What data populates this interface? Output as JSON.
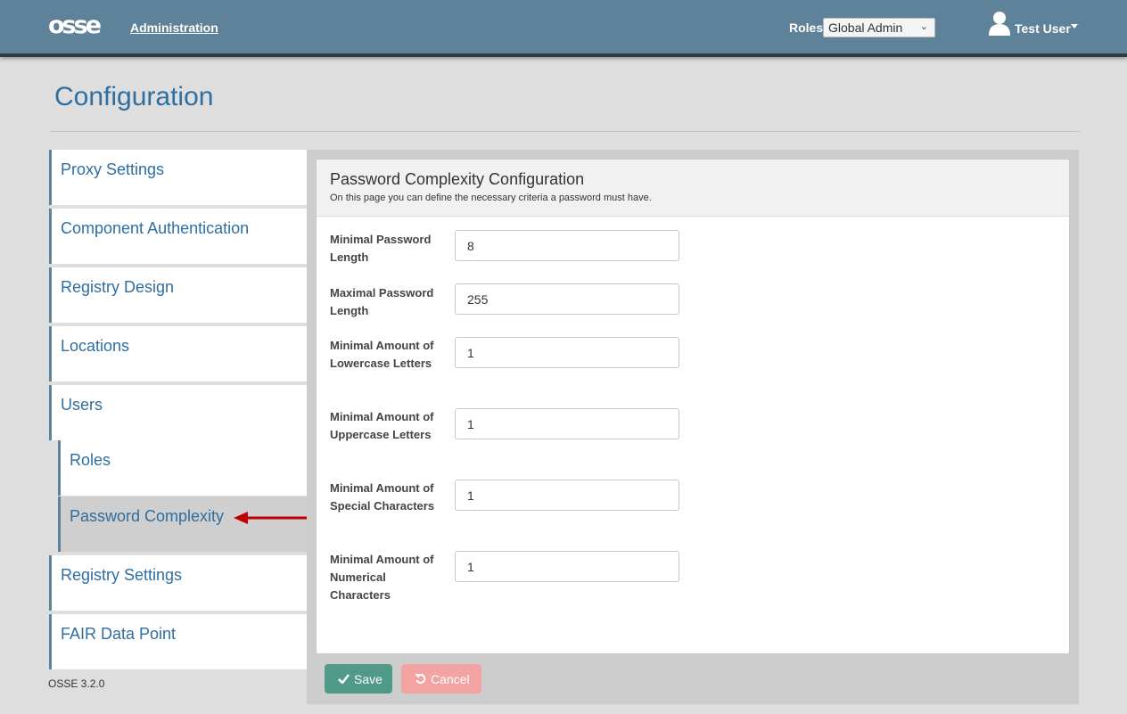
{
  "navbar": {
    "logo": "osse",
    "admin_link": "Administration",
    "roles_label": "Roles",
    "roles_selected": "Global Admin",
    "user_name": "Test User"
  },
  "page": {
    "title": "Configuration",
    "version": "OSSE 3.2.0"
  },
  "sidebar": {
    "items": [
      {
        "label": "Proxy Settings"
      },
      {
        "label": "Component Authentication"
      },
      {
        "label": "Registry Design"
      },
      {
        "label": "Locations"
      },
      {
        "label": "Users"
      },
      {
        "label": "Roles"
      },
      {
        "label": "Password Complexity"
      },
      {
        "label": "Registry Settings"
      },
      {
        "label": "FAIR Data Point"
      }
    ]
  },
  "card": {
    "title": "Password Complexity Configuration",
    "subtitle": "On this page you can define the necessary criteria a password must have."
  },
  "form": {
    "fields": [
      {
        "label": "Minimal Password Length",
        "value": "8"
      },
      {
        "label": "Maximal Password Length",
        "value": "255"
      },
      {
        "label": "Minimal Amount of Lowercase Letters",
        "value": "1"
      },
      {
        "label": "Minimal Amount of Uppercase Letters",
        "value": "1"
      },
      {
        "label": "Minimal Amount of Special Characters",
        "value": "1"
      },
      {
        "label": "Minimal Amount of Numerical Characters",
        "value": "1"
      }
    ]
  },
  "buttons": {
    "save": "Save",
    "cancel": "Cancel"
  },
  "colors": {
    "navbar": "#5e8299",
    "link": "#2f6ea0",
    "save": "#4f9a89",
    "cancel": "#f4a3a3",
    "arrow": "#c00000"
  }
}
